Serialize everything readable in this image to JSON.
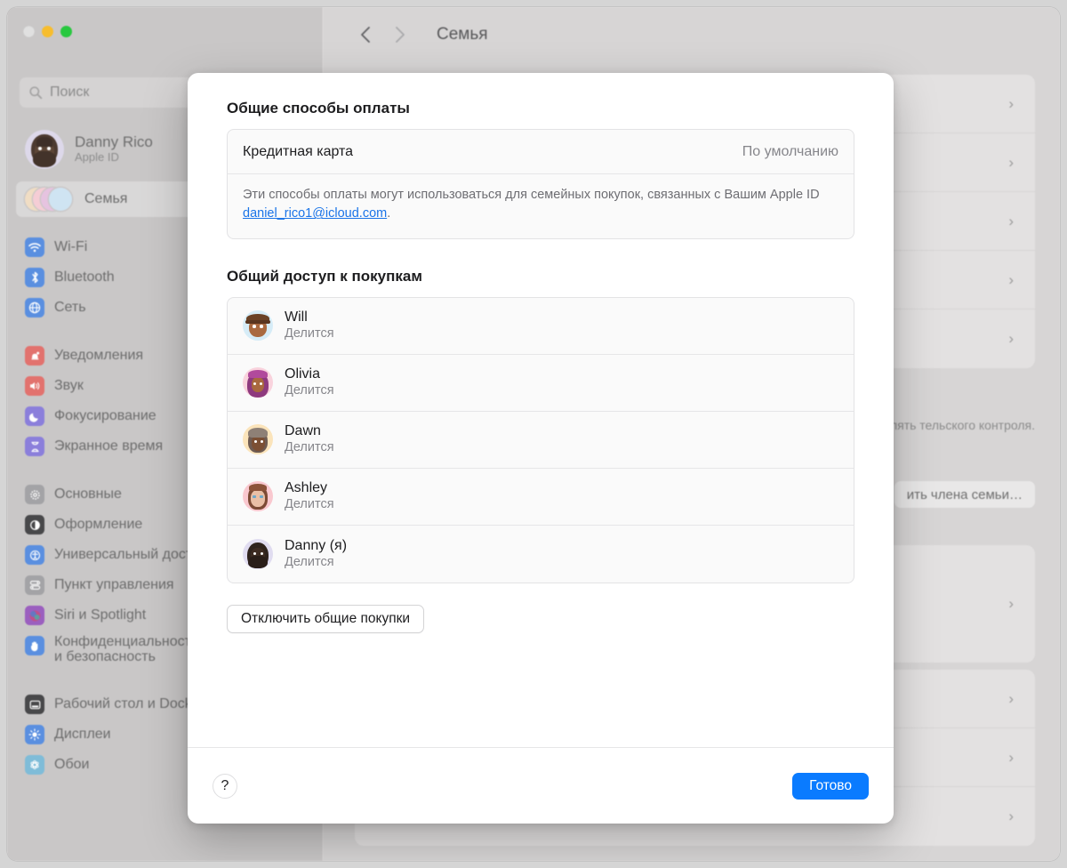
{
  "window": {
    "title": "Семья",
    "traffic_lights": [
      "close",
      "minimize",
      "zoom"
    ],
    "back_icon": "chevron-left-icon",
    "forward_icon": "chevron-right-icon"
  },
  "sidebar": {
    "search": {
      "placeholder": "Поиск",
      "icon": "search-icon"
    },
    "account": {
      "name": "Danny Rico",
      "subtitle": "Apple ID"
    },
    "family_row": {
      "label": "Семья",
      "selected": true
    },
    "items": [
      {
        "label": "Wi-Fi",
        "icon": "wifi-icon",
        "color": "#5a8fe0"
      },
      {
        "label": "Bluetooth",
        "icon": "bluetooth-icon",
        "color": "#5a8fe0"
      },
      {
        "label": "Сеть",
        "icon": "globe-icon",
        "color": "#5a8fe0"
      },
      {
        "label": "Уведомления",
        "icon": "bell-icon",
        "color": "#e2726e",
        "group_start": true
      },
      {
        "label": "Звук",
        "icon": "speaker-icon",
        "color": "#e2726e"
      },
      {
        "label": "Фокусирование",
        "icon": "moon-icon",
        "color": "#8b7fdb"
      },
      {
        "label": "Экранное время",
        "icon": "hourglass-icon",
        "color": "#8b7fdb"
      },
      {
        "label": "Основные",
        "icon": "gear-icon",
        "color": "#a3a3a6",
        "group_start": true
      },
      {
        "label": "Оформление",
        "icon": "appearance-icon",
        "color": "#48484a"
      },
      {
        "label": "Универсальный доступ",
        "icon": "accessibility-icon",
        "color": "#5a8fe0"
      },
      {
        "label": "Пункт управления",
        "icon": "control-center-icon",
        "color": "#a3a3a6"
      },
      {
        "label": "Siri и Spotlight",
        "icon": "siri-icon",
        "color": "#9b5fbf"
      },
      {
        "label": "Конфиденциальность и безопасность",
        "icon": "hand-icon",
        "color": "#5a8fe0"
      },
      {
        "label": "Рабочий стол и Dock",
        "icon": "desktop-dock-icon",
        "color": "#48484a",
        "group_start": true
      },
      {
        "label": "Дисплеи",
        "icon": "brightness-icon",
        "color": "#5a8fe0"
      },
      {
        "label": "Обои",
        "icon": "wallpaper-icon",
        "color": "#7fbcd8"
      }
    ]
  },
  "background_pane": {
    "note": "ать и предоставлять тельского контроля.",
    "add_member_button": "ить члена семьи…",
    "row_chevron": "chevron-right-icon",
    "row_count": 5
  },
  "sheet": {
    "payment_section": {
      "title": "Общие способы оплаты",
      "method_name": "Кредитная карта",
      "method_value": "По умолчанию",
      "note_prefix": "Эти способы оплаты могут использоваться для семейных покупок, связанных с Вашим Apple ID ",
      "note_link": "daniel_rico1@icloud.com",
      "note_suffix": "."
    },
    "sharing_section": {
      "title": "Общий доступ к покупкам",
      "members": [
        {
          "name": "Will",
          "status": "Делится",
          "avatar_bg": "#d6ecf7"
        },
        {
          "name": "Olivia",
          "status": "Делится",
          "avatar_bg": "#f9d3dd"
        },
        {
          "name": "Dawn",
          "status": "Делится",
          "avatar_bg": "#fbe4bb"
        },
        {
          "name": "Ashley",
          "status": "Делится",
          "avatar_bg": "#f9c8cf"
        },
        {
          "name": "Danny (я)",
          "status": "Делится",
          "avatar_bg": "#e0dcf0"
        }
      ],
      "turn_off_button": "Отключить общие покупки"
    },
    "footer": {
      "help_label": "?",
      "done_label": "Готово"
    }
  },
  "colors": {
    "accent": "#0a7bff",
    "link": "#1a74e8",
    "sheet_bg": "#ffffff",
    "window_bg": "#d7d5d5"
  }
}
